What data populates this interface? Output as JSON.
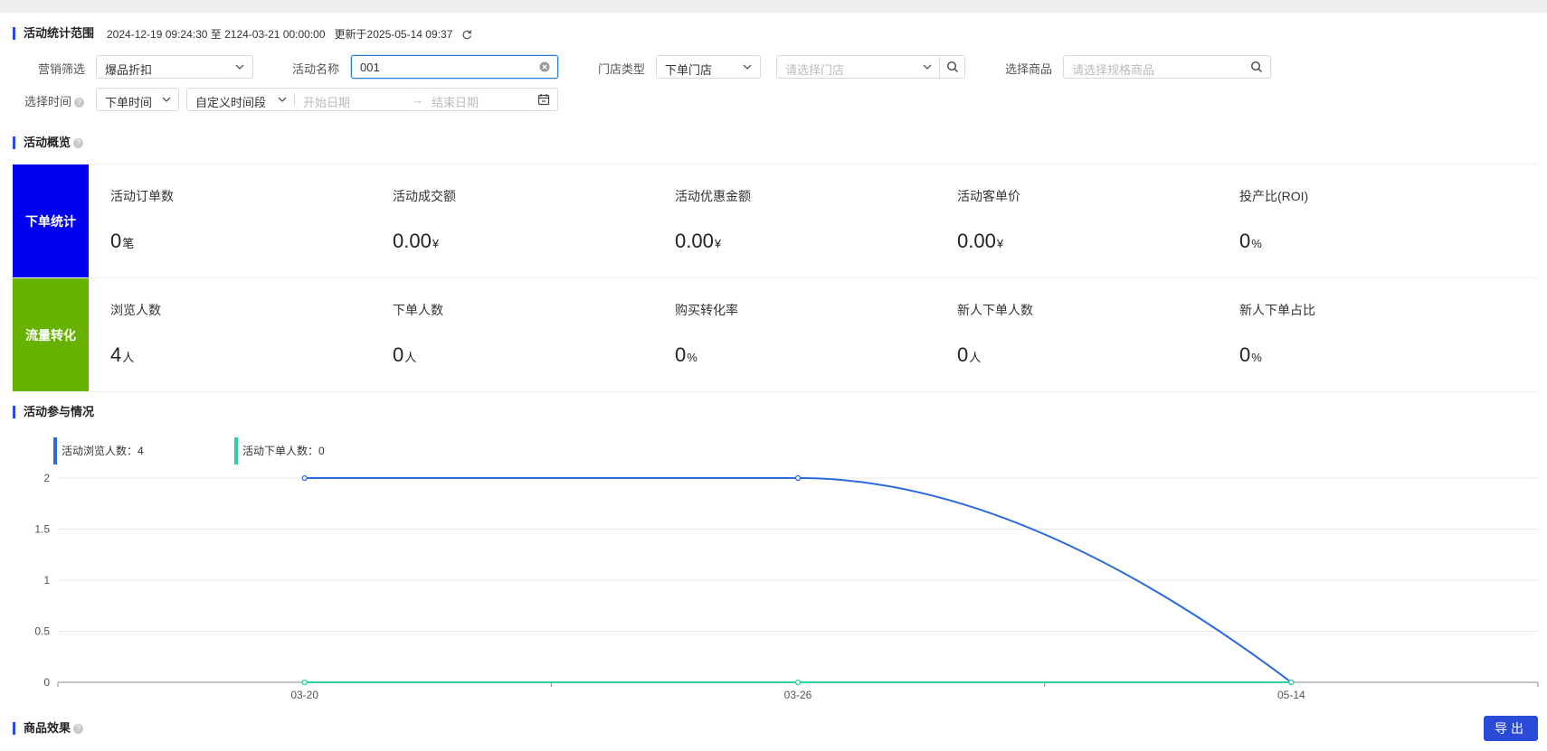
{
  "sections": {
    "range_title": "活动统计范围",
    "overview_title": "活动概览",
    "participation_title": "活动参与情况",
    "product_effect_title": "商品效果"
  },
  "range": {
    "period": "2024-12-19 09:24:30 至 2124-03-21 00:00:00",
    "updated": "更新于2025-05-14 09:37"
  },
  "filters": {
    "marketing_label": "营销筛选",
    "marketing_value": "爆品折扣",
    "activity_name_label": "活动名称",
    "activity_name_value": "001",
    "store_type_label": "门店类型",
    "store_type_value": "下单门店",
    "store_placeholder": "请选择门店",
    "product_label": "选择商品",
    "product_placeholder": "请选择规格商品",
    "time_label": "选择时间",
    "time_type_value": "下单时间",
    "time_range_value": "自定义时间段",
    "start_placeholder": "开始日期",
    "end_placeholder": "结束日期"
  },
  "overview": {
    "order_block": {
      "label": "下单统计",
      "color": "#0000ee"
    },
    "traffic_block": {
      "label": "流量转化",
      "color": "#67b100"
    },
    "order_metrics": [
      {
        "label": "活动订单数",
        "value": "0",
        "unit": "笔"
      },
      {
        "label": "活动成交额",
        "value": "0.00",
        "unit": "¥"
      },
      {
        "label": "活动优惠金额",
        "value": "0.00",
        "unit": "¥"
      },
      {
        "label": "活动客单价",
        "value": "0.00",
        "unit": "¥"
      },
      {
        "label": "投产比(ROI)",
        "value": "0",
        "unit": "%"
      }
    ],
    "traffic_metrics": [
      {
        "label": "浏览人数",
        "value": "4",
        "unit": "人"
      },
      {
        "label": "下单人数",
        "value": "0",
        "unit": "人"
      },
      {
        "label": "购买转化率",
        "value": "0",
        "unit": "%"
      },
      {
        "label": "新人下单人数",
        "value": "0",
        "unit": "人"
      },
      {
        "label": "新人下单占比",
        "value": "0",
        "unit": "%"
      }
    ]
  },
  "legend": {
    "browse": "活动浏览人数：4",
    "order": "活动下单人数：0"
  },
  "chart_data": {
    "type": "line",
    "categories": [
      "03-20",
      "03-26",
      "05-14"
    ],
    "series": [
      {
        "name": "活动浏览人数",
        "values": [
          2,
          2,
          0
        ],
        "color": "#2a6ae0"
      },
      {
        "name": "活动下单人数",
        "values": [
          0,
          0,
          0
        ],
        "color": "#2ad39a"
      }
    ],
    "y_ticks": [
      "0",
      "0.5",
      "1",
      "1.5",
      "2"
    ],
    "ylim": [
      0,
      2
    ],
    "grid": true,
    "legend_position": "top-left"
  },
  "actions": {
    "export_label": "导出"
  }
}
